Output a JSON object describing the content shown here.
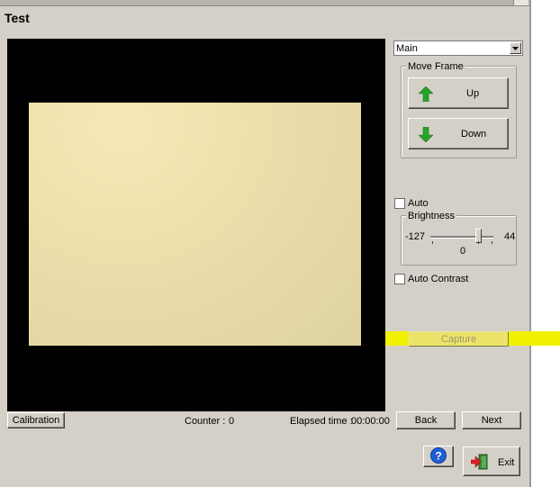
{
  "window": {
    "title": "Test"
  },
  "camera_select": {
    "value": "Main",
    "arrow_icon": "chevron-down-icon"
  },
  "move_frame": {
    "label": "Move Frame",
    "up_label": "Up",
    "down_label": "Down",
    "up_icon": "arrow-up-icon",
    "down_icon": "arrow-down-icon",
    "icon_color": "#2aa22a"
  },
  "auto": {
    "label": "Auto",
    "checked": false
  },
  "brightness": {
    "label": "Brightness",
    "min": "-127",
    "max": "44",
    "value": "0"
  },
  "auto_contrast": {
    "label": "Auto Contrast",
    "checked": false
  },
  "capture": {
    "label": "Capture",
    "enabled": false,
    "highlight_color": "#f2f200"
  },
  "footer": {
    "calibration_label": "Calibration",
    "counter_label": "Counter :",
    "counter_value": "0",
    "elapsed_label": "Elapsed time :",
    "elapsed_value": "00:00:00",
    "back_label": "Back",
    "next_label": "Next",
    "help_icon": "help-icon",
    "exit_label": "Exit",
    "exit_icon": "exit-door-icon"
  },
  "preview": {
    "background": "#000000",
    "frame_color": "#e8dba8"
  }
}
